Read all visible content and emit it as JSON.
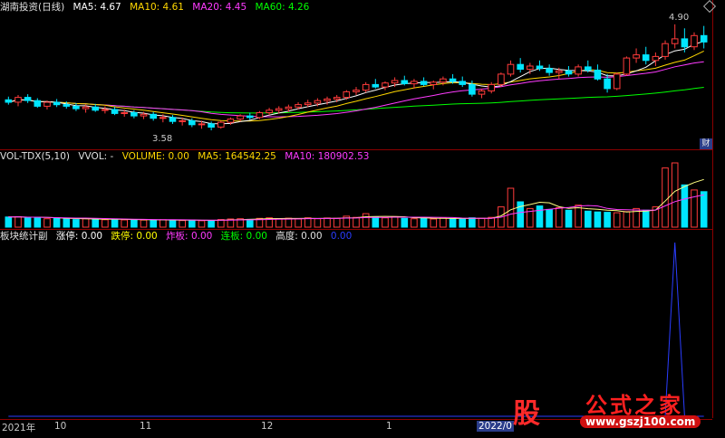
{
  "main_panel": {
    "title": "湖南投资(日线)",
    "ma5": "MA5: 4.67",
    "ma10": "MA10: 4.61",
    "ma20": "MA20: 4.45",
    "ma60": "MA60: 4.26",
    "high_marker": "4.90",
    "low_marker": "3.58",
    "badge": "财"
  },
  "vol_panel": {
    "name": "VOL-TDX(5,10)",
    "vvol": "VVOL: -",
    "volume": "VOLUME: 0.00",
    "ma5": "MA5: 164542.25",
    "ma10": "MA10: 180902.53"
  },
  "ind_panel": {
    "name": "板块统计副",
    "zhangting": "涨停: 0.00",
    "dieting": "跌停: 0.00",
    "zhaban": "炸板: 0.00",
    "lianban": "连板: 0.00",
    "gaodu": "高度: 0.00",
    "last": "0.00"
  },
  "time_axis": [
    "2021年",
    "10",
    "11",
    "12",
    "1",
    "2022/0"
  ],
  "watermark": {
    "gu": "股",
    "text": "公式之家",
    "url": "www.gszj100.com"
  },
  "colors": {
    "up": "#ff3b3b",
    "down": "#00e5ff",
    "ma5": "#ffffff",
    "ma10": "#ffd700",
    "ma20": "#ff3bff",
    "ma60": "#00ff00",
    "ind": "#2a3dff"
  },
  "chart_data": [
    {
      "type": "candlestick",
      "title": "湖南投资(日线)",
      "ylim": [
        3.4,
        5.0
      ],
      "ohlc": [
        [
          3.96,
          4.0,
          3.9,
          3.93
        ],
        [
          3.93,
          4.02,
          3.88,
          3.99
        ],
        [
          3.99,
          4.03,
          3.92,
          3.95
        ],
        [
          3.95,
          3.98,
          3.86,
          3.88
        ],
        [
          3.88,
          3.95,
          3.84,
          3.93
        ],
        [
          3.93,
          3.97,
          3.87,
          3.9
        ],
        [
          3.9,
          3.94,
          3.85,
          3.88
        ],
        [
          3.88,
          3.92,
          3.82,
          3.85
        ],
        [
          3.85,
          3.9,
          3.8,
          3.87
        ],
        [
          3.87,
          3.91,
          3.81,
          3.83
        ],
        [
          3.83,
          3.88,
          3.79,
          3.84
        ],
        [
          3.84,
          3.87,
          3.77,
          3.79
        ],
        [
          3.79,
          3.84,
          3.75,
          3.8
        ],
        [
          3.8,
          3.83,
          3.73,
          3.76
        ],
        [
          3.76,
          3.81,
          3.72,
          3.78
        ],
        [
          3.78,
          3.81,
          3.7,
          3.73
        ],
        [
          3.73,
          3.78,
          3.68,
          3.74
        ],
        [
          3.74,
          3.77,
          3.66,
          3.69
        ],
        [
          3.69,
          3.74,
          3.64,
          3.7
        ],
        [
          3.7,
          3.73,
          3.62,
          3.65
        ],
        [
          3.65,
          3.7,
          3.6,
          3.66
        ],
        [
          3.66,
          3.69,
          3.58,
          3.62
        ],
        [
          3.62,
          3.7,
          3.6,
          3.68
        ],
        [
          3.68,
          3.74,
          3.65,
          3.72
        ],
        [
          3.72,
          3.78,
          3.69,
          3.76
        ],
        [
          3.76,
          3.8,
          3.71,
          3.74
        ],
        [
          3.74,
          3.82,
          3.72,
          3.8
        ],
        [
          3.8,
          3.86,
          3.77,
          3.83
        ],
        [
          3.83,
          3.88,
          3.79,
          3.85
        ],
        [
          3.85,
          3.9,
          3.81,
          3.87
        ],
        [
          3.87,
          3.93,
          3.84,
          3.9
        ],
        [
          3.9,
          3.96,
          3.87,
          3.92
        ],
        [
          3.92,
          3.98,
          3.88,
          3.95
        ],
        [
          3.95,
          4.0,
          3.9,
          3.97
        ],
        [
          3.97,
          4.02,
          3.93,
          3.99
        ],
        [
          3.99,
          4.08,
          3.96,
          4.06
        ],
        [
          4.06,
          4.12,
          4.02,
          4.08
        ],
        [
          4.08,
          4.18,
          4.05,
          4.15
        ],
        [
          4.15,
          4.22,
          4.1,
          4.12
        ],
        [
          4.12,
          4.19,
          4.08,
          4.17
        ],
        [
          4.17,
          4.24,
          4.12,
          4.2
        ],
        [
          4.2,
          4.26,
          4.14,
          4.16
        ],
        [
          4.16,
          4.22,
          4.1,
          4.19
        ],
        [
          4.19,
          4.24,
          4.13,
          4.15
        ],
        [
          4.15,
          4.2,
          4.09,
          4.18
        ],
        [
          4.18,
          4.25,
          4.14,
          4.22
        ],
        [
          4.22,
          4.28,
          4.16,
          4.19
        ],
        [
          4.19,
          4.25,
          4.12,
          4.15
        ],
        [
          4.15,
          4.2,
          4.0,
          4.03
        ],
        [
          4.03,
          4.1,
          3.98,
          4.07
        ],
        [
          4.07,
          4.18,
          4.04,
          4.15
        ],
        [
          4.15,
          4.3,
          4.12,
          4.28
        ],
        [
          4.28,
          4.45,
          4.25,
          4.4
        ],
        [
          4.4,
          4.48,
          4.3,
          4.34
        ],
        [
          4.34,
          4.42,
          4.28,
          4.38
        ],
        [
          4.38,
          4.45,
          4.32,
          4.35
        ],
        [
          4.35,
          4.4,
          4.26,
          4.3
        ],
        [
          4.3,
          4.36,
          4.22,
          4.32
        ],
        [
          4.32,
          4.38,
          4.25,
          4.28
        ],
        [
          4.28,
          4.4,
          4.25,
          4.37
        ],
        [
          4.37,
          4.45,
          4.3,
          4.33
        ],
        [
          4.33,
          4.4,
          4.2,
          4.22
        ],
        [
          4.22,
          4.28,
          4.05,
          4.1
        ],
        [
          4.1,
          4.3,
          4.08,
          4.28
        ],
        [
          4.28,
          4.5,
          4.26,
          4.48
        ],
        [
          4.48,
          4.6,
          4.42,
          4.52
        ],
        [
          4.52,
          4.62,
          4.4,
          4.45
        ],
        [
          4.45,
          4.55,
          4.38,
          4.5
        ],
        [
          4.5,
          4.7,
          4.46,
          4.66
        ],
        [
          4.66,
          4.9,
          4.6,
          4.72
        ],
        [
          4.72,
          4.85,
          4.55,
          4.62
        ],
        [
          4.62,
          4.8,
          4.58,
          4.76
        ],
        [
          4.76,
          4.88,
          4.6,
          4.68
        ]
      ],
      "ma_values": {
        "MA5": 4.67,
        "MA10": 4.61,
        "MA20": 4.45,
        "MA60": 4.26
      },
      "annotations": [
        "4.90",
        "3.58"
      ]
    },
    {
      "type": "bar",
      "title": "VOL-TDX(5,10)",
      "values": [
        60,
        62,
        55,
        58,
        50,
        52,
        48,
        45,
        50,
        47,
        44,
        46,
        43,
        45,
        42,
        40,
        44,
        41,
        39,
        42,
        38,
        40,
        45,
        48,
        50,
        46,
        52,
        55,
        50,
        53,
        48,
        55,
        50,
        54,
        52,
        65,
        58,
        80,
        60,
        55,
        62,
        52,
        50,
        54,
        48,
        56,
        50,
        48,
        55,
        52,
        58,
        120,
        230,
        150,
        110,
        125,
        105,
        115,
        100,
        130,
        95,
        90,
        88,
        85,
        92,
        110,
        100,
        120,
        350,
        380,
        250,
        220,
        210
      ],
      "up": [
        false,
        true,
        false,
        false,
        true,
        false,
        false,
        false,
        true,
        false,
        true,
        false,
        true,
        false,
        true,
        false,
        true,
        false,
        true,
        false,
        true,
        false,
        true,
        true,
        true,
        false,
        true,
        true,
        true,
        true,
        true,
        true,
        true,
        true,
        true,
        true,
        true,
        true,
        false,
        true,
        true,
        false,
        true,
        false,
        true,
        true,
        false,
        false,
        false,
        true,
        true,
        true,
        true,
        false,
        true,
        false,
        false,
        true,
        false,
        true,
        false,
        false,
        false,
        true,
        true,
        true,
        false,
        true,
        true,
        true,
        false,
        true,
        false
      ],
      "ma5": 164542.25,
      "ma10": 180902.53
    },
    {
      "type": "line",
      "title": "板块统计副",
      "values": [
        0,
        0,
        0,
        0,
        0,
        0,
        0,
        0,
        0,
        0,
        0,
        0,
        0,
        0,
        0,
        0,
        0,
        0,
        0,
        0,
        0,
        0,
        0,
        0,
        0,
        0,
        0,
        0,
        0,
        0,
        0,
        0,
        0,
        0,
        0,
        0,
        0,
        0,
        0,
        0,
        0,
        0,
        0,
        0,
        0,
        0,
        0,
        0,
        0,
        0,
        0,
        0,
        0,
        0,
        0,
        0,
        0,
        0,
        0,
        0,
        0,
        0,
        0,
        0,
        0,
        0,
        0,
        0,
        0,
        1,
        0,
        0,
        0
      ]
    }
  ]
}
